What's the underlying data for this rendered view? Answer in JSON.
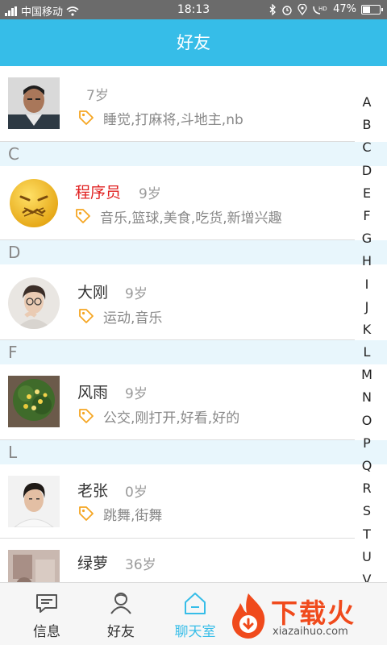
{
  "status_bar": {
    "carrier": "中国移动",
    "time": "18:13",
    "battery": "47%",
    "battery_level": 0.47,
    "icons": [
      "signal-icon",
      "wifi-icon",
      "bluetooth-icon",
      "alarm-icon",
      "location-icon",
      "hd-call-icon",
      "battery-icon"
    ]
  },
  "header": {
    "title": "好友"
  },
  "friends": [
    {
      "name": "",
      "age": "7岁",
      "tags": "睡觉,打麻将,斗地主,nb",
      "avatar": "man-photo"
    },
    {
      "section": "C"
    },
    {
      "name": "程序员",
      "age": "9岁",
      "tags": "音乐,篮球,美食,吃货,新增兴趣",
      "avatar": "sick-emoji",
      "name_color": "#e02020"
    },
    {
      "section": "D"
    },
    {
      "name": "大刚",
      "age": "9岁",
      "tags": "运动,音乐",
      "avatar": "glasses-guy-photo"
    },
    {
      "section": "F"
    },
    {
      "name": "风雨",
      "age": "9岁",
      "tags": "公交,刚打开,好看,好的",
      "avatar": "flower-photo"
    },
    {
      "section": "L"
    },
    {
      "name": "老张",
      "age": "0岁",
      "tags": "跳舞,街舞",
      "avatar": "man-portrait-photo"
    },
    {
      "name": "绿萝",
      "age": "36岁",
      "tags": "",
      "avatar": "room-photo"
    }
  ],
  "index_letters": [
    "A",
    "B",
    "C",
    "D",
    "E",
    "F",
    "G",
    "H",
    "I",
    "J",
    "K",
    "L",
    "M",
    "N",
    "O",
    "P",
    "Q",
    "R",
    "S",
    "T",
    "U",
    "V"
  ],
  "tabs": [
    {
      "label": "信息",
      "icon": "message-icon"
    },
    {
      "label": "好友",
      "icon": "friends-icon"
    },
    {
      "label": "聊天室",
      "icon": "chatroom-home-icon",
      "active": true
    }
  ],
  "watermark": {
    "text": "下载火",
    "url": "xiazaihuo.com"
  },
  "colors": {
    "accent": "#36bde8",
    "section_bg": "#e8f6fc",
    "tag_icon": "#f5a623",
    "highlight_name": "#e02020"
  }
}
